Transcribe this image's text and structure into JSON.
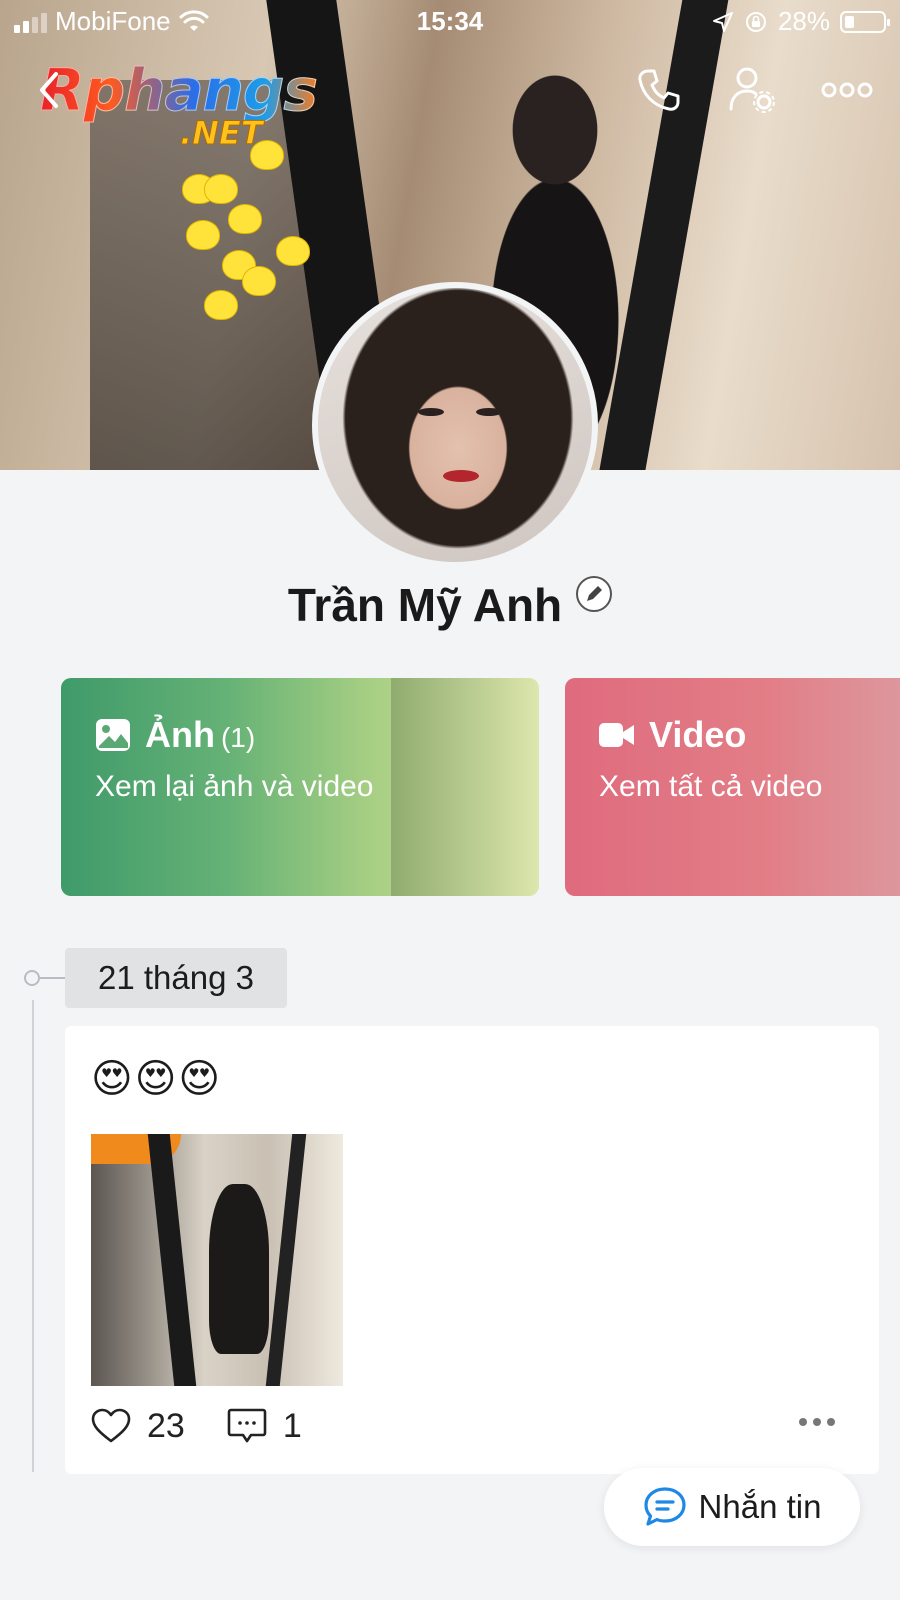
{
  "status_bar": {
    "carrier": "MobiFone",
    "time": "15:34",
    "battery": "28%"
  },
  "watermark": {
    "main": "Rphangs",
    "sub": ".NET"
  },
  "profile": {
    "name": "Trần Mỹ Anh"
  },
  "media_cards": {
    "photos": {
      "title": "Ảnh",
      "count": "(1)",
      "subtitle": "Xem lại ảnh và video"
    },
    "videos": {
      "title": "Video",
      "subtitle": "Xem tất cả video"
    }
  },
  "timeline": {
    "date": "21 tháng 3",
    "post": {
      "text": "😍😍😍",
      "likes": "23",
      "comments": "1"
    }
  },
  "message_button": {
    "label": "Nhắn tin"
  },
  "icons": {
    "header": [
      "back-icon",
      "phone-icon",
      "user-settings-icon",
      "more-icon"
    ],
    "cards": [
      "image-icon",
      "video-camera-icon"
    ],
    "post": [
      "heart-icon",
      "comment-icon",
      "more-horizontal-icon"
    ],
    "message": "chat-bubble-icon"
  },
  "colors": {
    "photos_card": "#66b276",
    "videos_card": "#e27d86",
    "message_icon": "#1e88e5"
  }
}
